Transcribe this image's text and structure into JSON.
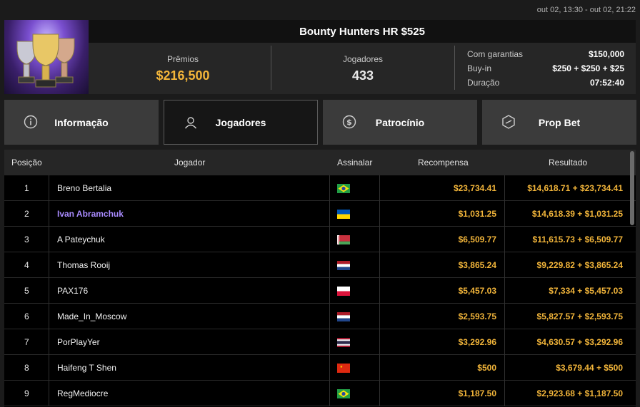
{
  "topbar": {
    "date_range": "out 02, 13:30 - out 02, 21:22"
  },
  "tournament": {
    "title": "Bounty Hunters HR $525",
    "prizes_label": "Prêmios",
    "prizes_value": "$216,500",
    "players_label": "Jogadores",
    "players_value": "433",
    "details": [
      {
        "key": "Com garantias",
        "value": "$150,000"
      },
      {
        "key": "Buy-in",
        "value": "$250 + $250 + $25"
      },
      {
        "key": "Duração",
        "value": "07:52:40"
      }
    ]
  },
  "tabs": [
    {
      "label": "Informação",
      "icon": "info-icon"
    },
    {
      "label": "Jogadores",
      "icon": "user-icon",
      "active": true
    },
    {
      "label": "Patrocínio",
      "icon": "dollar-coin-icon"
    },
    {
      "label": "Prop Bet",
      "icon": "prop-bet-icon"
    }
  ],
  "table": {
    "headers": {
      "position": "Posição",
      "player": "Jogador",
      "flag": "Assinalar",
      "reward": "Recompensa",
      "result": "Resultado"
    },
    "rows": [
      {
        "pos": "1",
        "player": "Breno Bertalia",
        "flag": "brazil",
        "reward": "$23,734.41",
        "result": "$14,618.71 + $23,734.41"
      },
      {
        "pos": "2",
        "player": "Ivan Abramchuk",
        "flag": "ukraine",
        "reward": "$1,031.25",
        "result": "$14,618.39 + $1,031.25",
        "highlight": true
      },
      {
        "pos": "3",
        "player": "A Pateychuk",
        "flag": "belarus",
        "reward": "$6,509.77",
        "result": "$11,615.73 + $6,509.77"
      },
      {
        "pos": "4",
        "player": "Thomas Rooij",
        "flag": "netherlands",
        "reward": "$3,865.24",
        "result": "$9,229.82 + $3,865.24"
      },
      {
        "pos": "5",
        "player": "PAX176",
        "flag": "poland",
        "reward": "$5,457.03",
        "result": "$7,334 + $5,457.03"
      },
      {
        "pos": "6",
        "player": "Made_In_Moscow",
        "flag": "netherlands",
        "reward": "$2,593.75",
        "result": "$5,827.57 + $2,593.75"
      },
      {
        "pos": "7",
        "player": "PorPlayYer",
        "flag": "thailand",
        "reward": "$3,292.96",
        "result": "$4,630.57 + $3,292.96"
      },
      {
        "pos": "8",
        "player": "Haifeng T Shen",
        "flag": "china",
        "reward": "$500",
        "result": "$3,679.44 + $500"
      },
      {
        "pos": "9",
        "player": "RegMediocre",
        "flag": "brazil",
        "reward": "$1,187.50",
        "result": "$2,923.68 + $1,187.50"
      }
    ]
  },
  "colors": {
    "accent_gold": "#f2b53a",
    "highlight_purple": "#a98bff"
  }
}
